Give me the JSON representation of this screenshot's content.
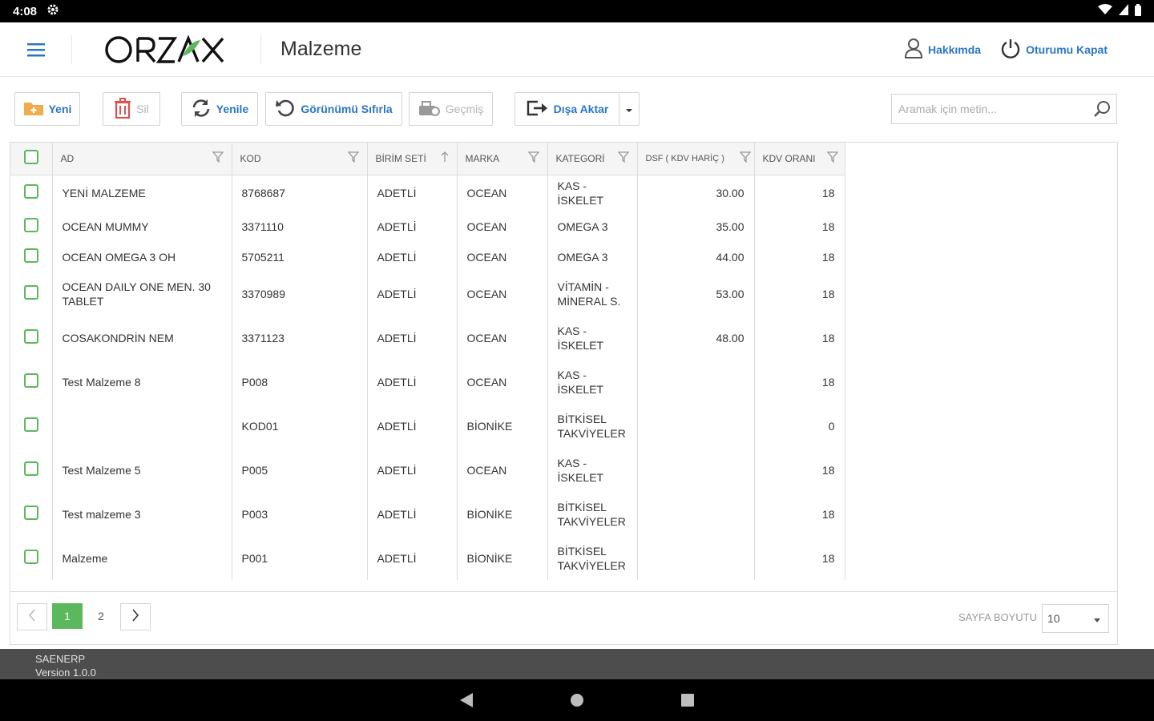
{
  "status_bar": {
    "time": "4:08"
  },
  "header": {
    "logo": "ORZAX",
    "page_title": "Malzeme",
    "about_label": "Hakkımda",
    "logout_label": "Oturumu Kapat"
  },
  "toolbar": {
    "new_label": "Yeni",
    "delete_label": "Sil",
    "refresh_label": "Yenile",
    "reset_view_label": "Görünümü Sıfırla",
    "history_label": "Geçmiş",
    "export_label": "Dışa Aktar",
    "search_placeholder": "Aramak için metin..."
  },
  "table": {
    "columns": [
      "AD",
      "KOD",
      "BİRİM SETİ",
      "MARKA",
      "KATEGORİ",
      "DSF ( KDV HARİÇ )",
      "KDV ORANI"
    ],
    "rows": [
      {
        "ad": "YENİ MALZEME",
        "kod": "8768687",
        "birim": "ADETLİ",
        "marka": "OCEAN",
        "kategori": "KAS - İSKELET",
        "dsf": "30.00",
        "kdv": "18"
      },
      {
        "ad": "OCEAN MUMMY",
        "kod": "3371110",
        "birim": "ADETLİ",
        "marka": "OCEAN",
        "kategori": "OMEGA 3",
        "dsf": "35.00",
        "kdv": "18"
      },
      {
        "ad": "OCEAN OMEGA 3 OH",
        "kod": "5705211",
        "birim": "ADETLİ",
        "marka": "OCEAN",
        "kategori": "OMEGA 3",
        "dsf": "44.00",
        "kdv": "18"
      },
      {
        "ad": "OCEAN DAILY ONE MEN. 30 TABLET",
        "kod": "3370989",
        "birim": "ADETLİ",
        "marka": "OCEAN",
        "kategori": "VİTAMİN - MİNERAL S.",
        "dsf": "53.00",
        "kdv": "18"
      },
      {
        "ad": "COSAKONDRİN NEM",
        "kod": "3371123",
        "birim": "ADETLİ",
        "marka": "OCEAN",
        "kategori": "KAS - İSKELET",
        "dsf": "48.00",
        "kdv": "18"
      },
      {
        "ad": "Test Malzeme 8",
        "kod": "P008",
        "birim": "ADETLİ",
        "marka": "OCEAN",
        "kategori": "KAS - İSKELET",
        "dsf": "",
        "kdv": "18"
      },
      {
        "ad": "",
        "kod": "KOD01",
        "birim": "ADETLİ",
        "marka": "BİONİKE",
        "kategori": "BİTKİSEL TAKVİYELER",
        "dsf": "",
        "kdv": "0"
      },
      {
        "ad": "Test Malzeme 5",
        "kod": "P005",
        "birim": "ADETLİ",
        "marka": "OCEAN",
        "kategori": "KAS - İSKELET",
        "dsf": "",
        "kdv": "18"
      },
      {
        "ad": "Test malzeme 3",
        "kod": "P003",
        "birim": "ADETLİ",
        "marka": "BİONİKE",
        "kategori": "BİTKİSEL TAKVİYELER",
        "dsf": "",
        "kdv": "18"
      },
      {
        "ad": "Malzeme",
        "kod": "P001",
        "birim": "ADETLİ",
        "marka": "BİONİKE",
        "kategori": "BİTKİSEL TAKVİYELER",
        "dsf": "",
        "kdv": "18"
      }
    ]
  },
  "pager": {
    "pages": [
      "1",
      "2"
    ],
    "current_page": "1",
    "page_size_label": "SAYFA BOYUTU",
    "page_size_value": "10"
  },
  "footer": {
    "app_name": "SAENERP",
    "version": "Version 1.0.0"
  },
  "colors": {
    "accent_blue": "#2a76c6",
    "accent_green": "#5cb85c",
    "delete_red": "#d9534f",
    "toolbar_orange": "#f0ad4e",
    "footer_bg": "#4d4d4d"
  },
  "icons": [
    "menu-icon",
    "user-icon",
    "power-icon",
    "folder-plus-icon",
    "trash-icon",
    "refresh-icon",
    "undo-icon",
    "history-icon",
    "export-icon",
    "search-icon",
    "filter-icon",
    "sort-arrow-icon",
    "chevron-left-icon",
    "chevron-right-icon"
  ]
}
